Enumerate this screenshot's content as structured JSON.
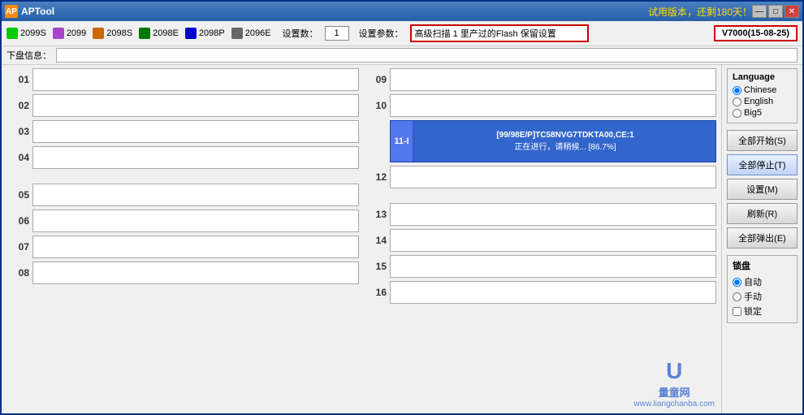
{
  "window": {
    "title": "APTool",
    "trial_text": "试用版本，还剩180天！",
    "controls": {
      "minimize": "—",
      "maximize": "□",
      "close": "✕"
    }
  },
  "toolbar": {
    "legends": [
      {
        "id": "2099S",
        "label": "2099S",
        "color": "#00cc00"
      },
      {
        "id": "2099",
        "label": "2099",
        "color": "#aa44cc"
      },
      {
        "id": "2098S",
        "label": "2098S",
        "color": "#cc6600"
      },
      {
        "id": "2098E",
        "label": "2098E",
        "color": "#007700"
      },
      {
        "id": "2098P",
        "label": "2098P",
        "color": "#0000cc"
      },
      {
        "id": "2096E",
        "label": "2096E",
        "color": "#666666"
      }
    ],
    "device_count_label": "设置数：",
    "device_count_value": "1",
    "settings_param_label": "设置参数：",
    "settings_param_value": "高级扫描 1 里产过的Flash 保留设置",
    "version": "V7000(15-08-25)"
  },
  "info_bar": {
    "label": "下盘信息：",
    "value": ""
  },
  "slots": {
    "left": [
      {
        "num": "01",
        "content": "",
        "active": false
      },
      {
        "num": "02",
        "content": "",
        "active": false
      },
      {
        "num": "03",
        "content": "",
        "active": false
      },
      {
        "num": "04",
        "content": "",
        "active": false
      },
      {
        "separator": true
      },
      {
        "num": "05",
        "content": "",
        "active": false
      },
      {
        "num": "06",
        "content": "",
        "active": false
      },
      {
        "num": "07",
        "content": "",
        "active": false
      },
      {
        "num": "08",
        "content": "",
        "active": false
      }
    ],
    "right": [
      {
        "num": "09",
        "content": "",
        "active": false
      },
      {
        "num": "10",
        "content": "",
        "active": false
      },
      {
        "num": "11",
        "content": "",
        "active": true,
        "active_label": "11-I",
        "line1": "[99/98E/P]TC58NVG7TDKTA00,CE:1",
        "line2": "正在进行，请稍候... [86.7%]"
      },
      {
        "num": "12",
        "content": "",
        "active": false
      },
      {
        "separator": true
      },
      {
        "num": "13",
        "content": "",
        "active": false
      },
      {
        "num": "14",
        "content": "",
        "active": false
      },
      {
        "num": "15",
        "content": "",
        "active": false
      },
      {
        "num": "16",
        "content": "",
        "active": false
      }
    ]
  },
  "right_panel": {
    "language": {
      "title": "Language",
      "options": [
        {
          "label": "Chinese",
          "selected": true
        },
        {
          "label": "English",
          "selected": false
        },
        {
          "label": "Big5",
          "selected": false
        }
      ]
    },
    "buttons": [
      {
        "id": "start-all",
        "label": "全部开始(S)"
      },
      {
        "id": "stop-all",
        "label": "全部停止(T)",
        "highlight": true
      },
      {
        "id": "settings",
        "label": "设置(M)"
      },
      {
        "id": "refresh",
        "label": "刷新(R)"
      },
      {
        "id": "eject-all",
        "label": "全部弹出(E)"
      }
    ],
    "lock": {
      "title": "锁盘",
      "options": [
        {
          "label": "自动",
          "type": "radio",
          "selected": true
        },
        {
          "label": "手动",
          "type": "radio",
          "selected": false
        },
        {
          "label": "锁定",
          "type": "checkbox",
          "selected": false
        }
      ]
    }
  },
  "watermark": {
    "icon": "U",
    "site_name": "量童网",
    "url": "www.liangchanba.com"
  }
}
